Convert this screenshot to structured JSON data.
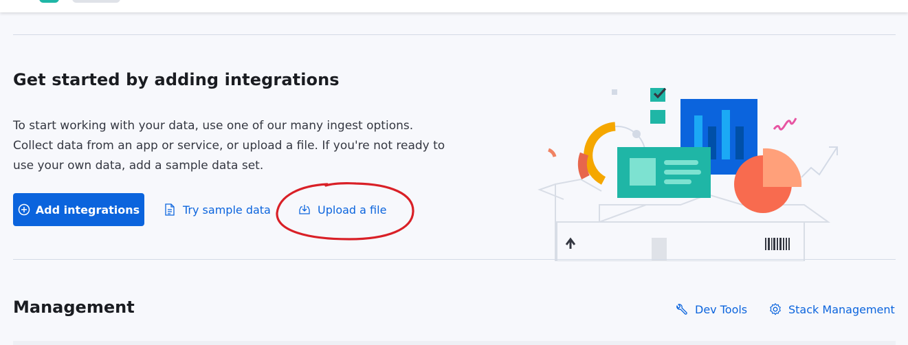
{
  "integrations": {
    "title": "Get started by adding integrations",
    "description": "To start working with your data, use one of our many ingest options. Collect data from an app or service, or upload a file. If you're not ready to use your own data, add a sample data set.",
    "add_button": {
      "label": "Add integrations",
      "icon": "plus-circle-icon"
    },
    "sample_link": {
      "label": "Try sample data",
      "icon": "document-icon"
    },
    "upload_link": {
      "label": "Upload a file",
      "icon": "download-tray-icon"
    }
  },
  "management": {
    "title": "Management",
    "links": [
      {
        "label": "Dev Tools",
        "icon": "wrench-icon"
      },
      {
        "label": "Stack Management",
        "icon": "gear-icon"
      }
    ]
  },
  "colors": {
    "primary": "#0b64dd",
    "teal": "#1fb6a6",
    "annotation": "#d92027",
    "background": "#f7f8fc"
  }
}
